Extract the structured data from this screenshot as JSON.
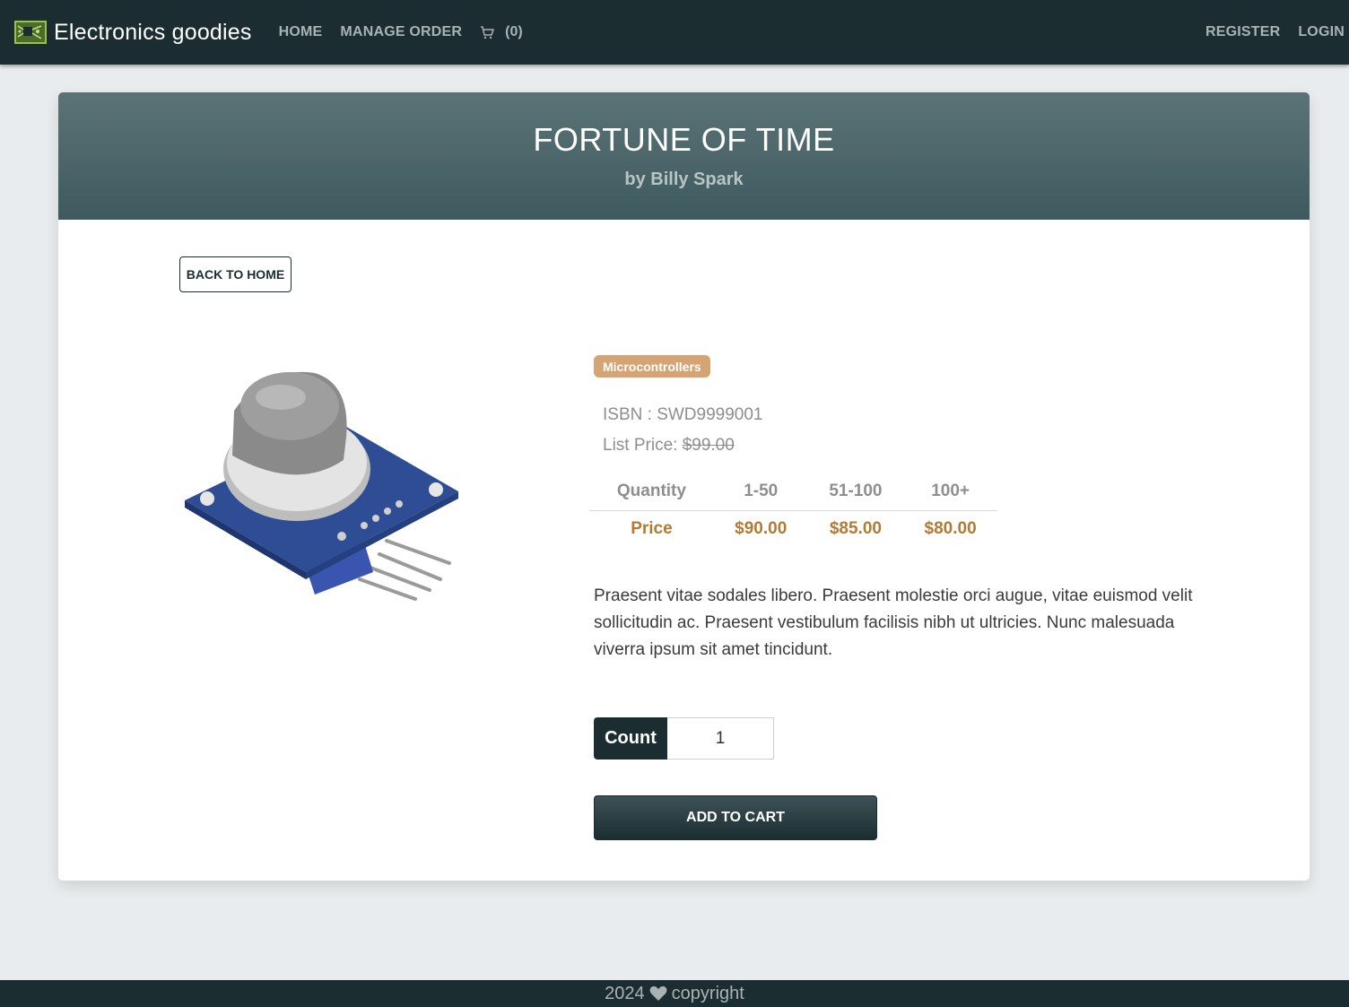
{
  "nav": {
    "brand": "Electronics goodies",
    "links": [
      "HOME",
      "MANAGE ORDER"
    ],
    "cart_count": "(0)",
    "register": "REGISTER",
    "login": "LOGIN"
  },
  "product": {
    "title": "FORTUNE OF TIME",
    "author": "by Billy Spark",
    "back_label": "BACK TO HOME",
    "category": "Microcontrollers",
    "isbn_label": "ISBN : ",
    "isbn": "SWD9999001",
    "list_price_label": "List Price: ",
    "list_price": "$99.00",
    "pricing": {
      "headers": [
        "Quantity",
        "1-50",
        "51-100",
        "100+"
      ],
      "row_label": "Price",
      "prices": [
        "$90.00",
        "$85.00",
        "$80.00"
      ]
    },
    "description": "Praesent vitae sodales libero. Praesent molestie orci augue, vitae euismod velit sollicitudin ac. Praesent vestibulum facilisis nibh ut ultricies. Nunc malesuada viverra ipsum sit amet tincidunt.",
    "count_label": "Count",
    "count_value": "1",
    "add_label": "ADD TO CART"
  },
  "footer": {
    "year": "2024",
    "text": "copyright"
  },
  "colors": {
    "nav_bg": "#1b2d31",
    "header_gradient_top": "#5b7376",
    "header_gradient_bottom": "#3e5a5f",
    "badge": "#d4a474",
    "price": "#b27a32",
    "page_bg": "#e9ecee"
  }
}
